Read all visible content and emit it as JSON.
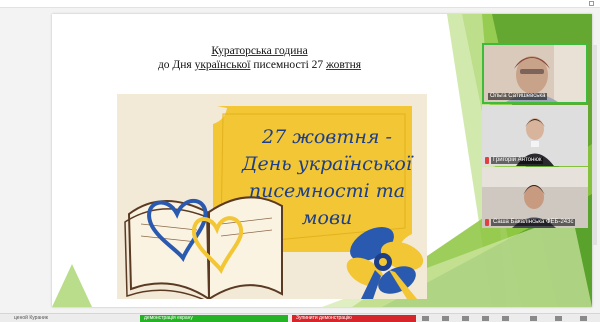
{
  "slide": {
    "title_line1": "Кураторська година",
    "title_line2_prefix": "до Дня ",
    "title_line2_underlined": "української",
    "title_line2_mid": " писемності 27 ",
    "title_line2_underlined2": "жовтня"
  },
  "poster": {
    "line1": "27 жовтня -",
    "line2": "День української",
    "line3": "писемності та мови"
  },
  "participants": [
    {
      "name": "Ольга Сатишевська",
      "highlighted": true,
      "muted": false
    },
    {
      "name": "Григорій Антонюк",
      "highlighted": false,
      "muted": true
    },
    {
      "name": "Саша Бакалінська ФЕБ-243с",
      "highlighted": false,
      "muted": true
    }
  ],
  "taskbar": {
    "left_label": "ценой Кураник",
    "green_label": "демонстрація екрану",
    "red_label": "Зупинити демонстрацію"
  },
  "colors": {
    "accent_green": "#3dbb3d",
    "poster_yellow": "#f2c635",
    "poster_blue": "#1d3f8a",
    "taskbar_green": "#24b324",
    "taskbar_red": "#d7262b"
  },
  "icons": [
    "window-corner-icon",
    "book-icon",
    "heart-icon",
    "ribbon-bow-icon",
    "mic-muted-icon"
  ]
}
